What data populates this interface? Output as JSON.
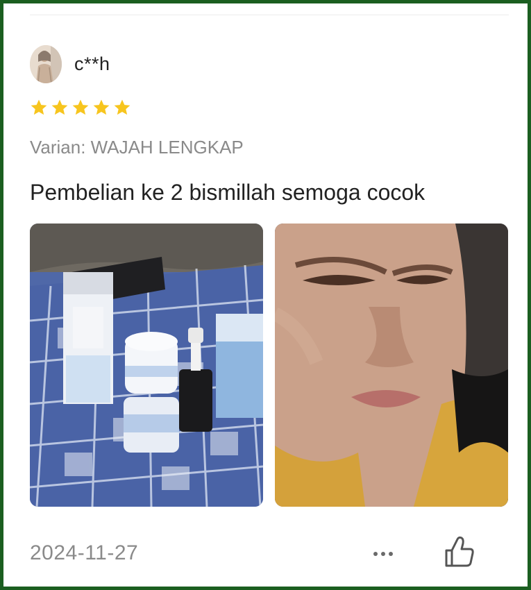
{
  "review": {
    "username": "c**h",
    "rating": 5,
    "variant_text": "Varian: WAJAH LENGKAP",
    "text": "Pembelian ke 2 bismillah semoga cocok",
    "photos": [
      "product-photo",
      "face-photo"
    ],
    "date": "2024-11-27"
  },
  "actions": {
    "more_icon": "more-dots-icon",
    "like_icon": "thumbs-up-icon"
  },
  "colors": {
    "star": "#f7c51e",
    "frame": "#1b5e20",
    "muted_text": "#8a8a8a"
  }
}
